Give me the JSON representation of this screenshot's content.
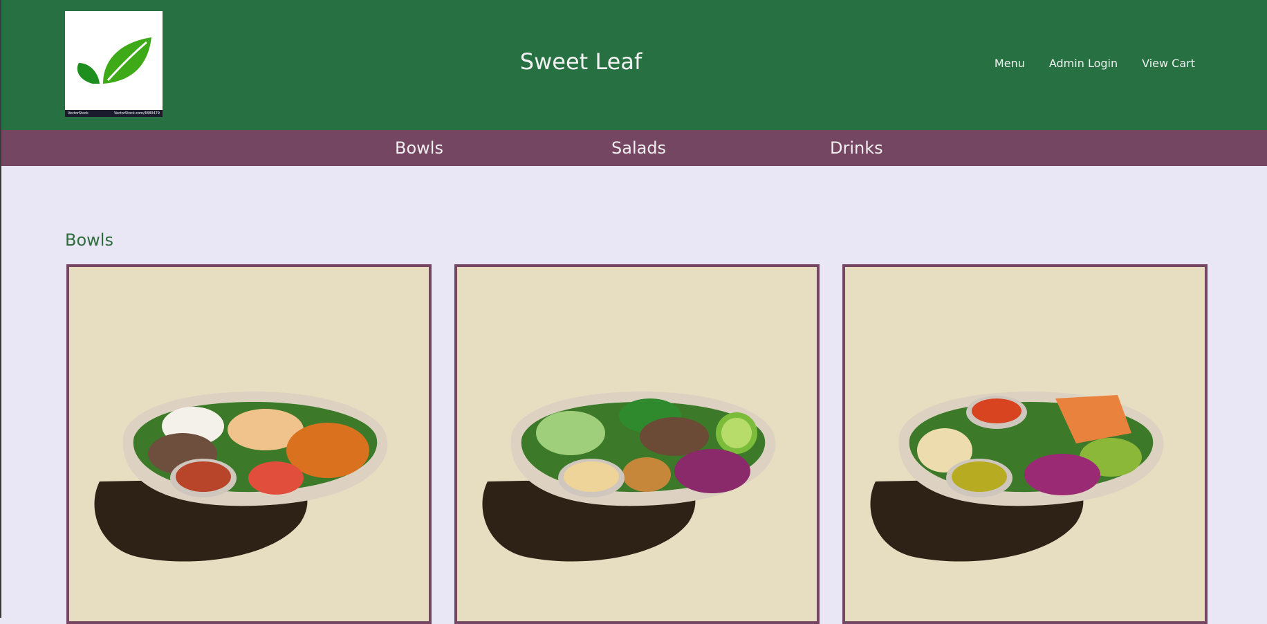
{
  "header": {
    "logo_alt": "leaf-logo",
    "logo_caption_left": "VectorStock",
    "logo_caption_right": "VectorStock.com/4880479",
    "title": "Sweet Leaf",
    "nav": [
      "Menu",
      "Admin Login",
      "View Cart"
    ]
  },
  "categories": [
    "Bowls",
    "Salads",
    "Drinks"
  ],
  "section": {
    "heading": "Bowls"
  },
  "products": [
    {
      "image": "bowl-1-apple-sweet-potato",
      "sauce_color": "#b8452a"
    },
    {
      "image": "bowl-2-chicken-lime",
      "sauce_color": "#efd49a"
    },
    {
      "image": "bowl-3-salmon-avocado",
      "sauce_color": "#b7ab22"
    }
  ],
  "colors": {
    "header_green": "#267042",
    "category_bar": "#754661",
    "page_background": "#e9e7f5",
    "card_background": "#e7ddc1",
    "section_heading": "#2e6a3b"
  }
}
